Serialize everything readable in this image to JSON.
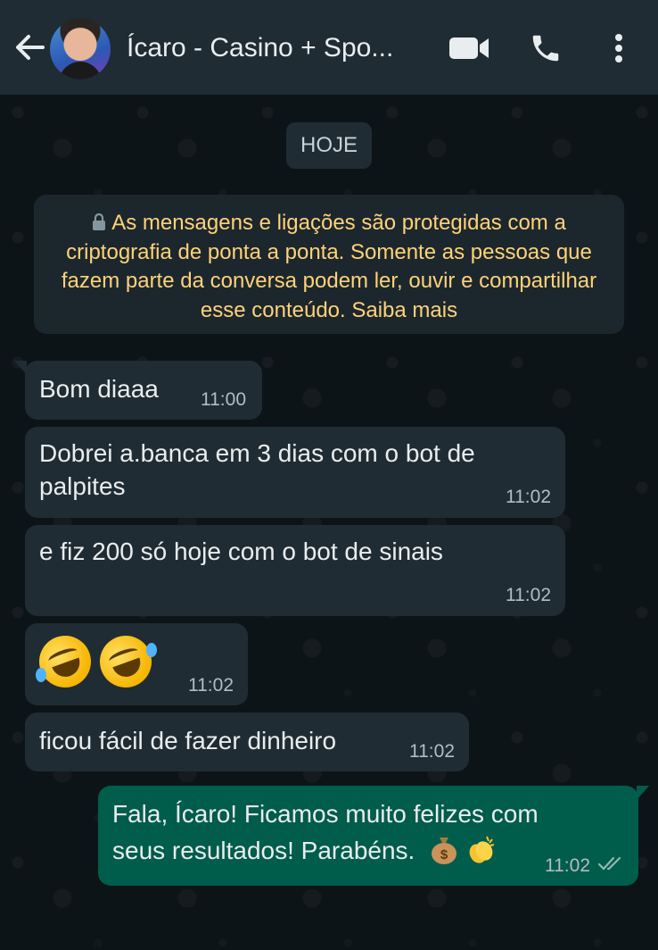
{
  "header": {
    "title": "Ícaro - Casino + Spo...",
    "back_icon": "arrow-left-icon",
    "video_icon": "video-call-icon",
    "call_icon": "phone-icon",
    "menu_icon": "more-vertical-icon"
  },
  "date_chip": "HOJE",
  "encryption_notice": "As mensagens e ligações são protegidas com a criptografia de ponta a ponta. Somente as pessoas que fazem parte da conversa podem ler, ouvir e compartilhar esse conteúdo. Saiba mais",
  "messages": [
    {
      "direction": "in",
      "text": "Bom diaaa",
      "time": "11:00"
    },
    {
      "direction": "in",
      "line1": "Dobrei a.banca em 3 dias com o bot de",
      "line2": "palpites",
      "time": "11:02"
    },
    {
      "direction": "in",
      "text": "e fiz 200 só hoje com o bot de sinais",
      "time": "11:02"
    },
    {
      "direction": "in",
      "emoji": "🤣🤣",
      "time": "11:02"
    },
    {
      "direction": "in",
      "text": "ficou fácil de fazer dinheiro",
      "time": "11:02"
    },
    {
      "direction": "out",
      "line1": "Fala, Ícaro! Ficamos muito felizes com",
      "line2": "seus resultados! Parabéns.",
      "emoji": "💰👏",
      "time": "11:02",
      "status": "read"
    }
  ],
  "colors": {
    "header_bg": "#1f2c33",
    "incoming_bubble": "#202c33",
    "outgoing_bubble": "#005c4b",
    "notice_text": "#ffd279"
  }
}
